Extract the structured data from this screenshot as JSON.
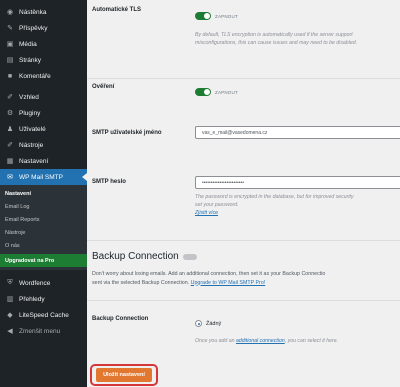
{
  "sidebar": {
    "items_top": [
      {
        "label": "Nástěnka",
        "icon": "dashboard-icon"
      },
      {
        "label": "Příspěvky",
        "icon": "pin-icon"
      },
      {
        "label": "Média",
        "icon": "media-icon"
      },
      {
        "label": "Stránky",
        "icon": "pages-icon"
      },
      {
        "label": "Komentáře",
        "icon": "comments-icon"
      }
    ],
    "items_mid": [
      {
        "label": "Vzhled",
        "icon": "appearance-icon"
      },
      {
        "label": "Pluginy",
        "icon": "plugins-icon"
      },
      {
        "label": "Uživatelé",
        "icon": "users-icon"
      },
      {
        "label": "Nástroje",
        "icon": "tools-icon"
      },
      {
        "label": "Nastavení",
        "icon": "settings-icon"
      }
    ],
    "active": {
      "label": "WP Mail SMTP",
      "icon": "mail-icon"
    },
    "submenu": [
      {
        "label": "Nastavení",
        "state": "current"
      },
      {
        "label": "Email Log",
        "state": ""
      },
      {
        "label": "Email Reports",
        "state": ""
      },
      {
        "label": "Nástroje",
        "state": ""
      },
      {
        "label": "O nás",
        "state": ""
      },
      {
        "label": "Upgradovat na Pro",
        "state": "upgrade"
      }
    ],
    "items_bottom": [
      {
        "label": "Wordfence",
        "icon": "shield-icon"
      },
      {
        "label": "Přehledy",
        "icon": "insights-icon"
      },
      {
        "label": "LiteSpeed Cache",
        "icon": "cache-icon"
      },
      {
        "label": "Zmenšit menu",
        "icon": "collapse-icon"
      }
    ]
  },
  "settings": {
    "auto_tls": {
      "label": "Automatické TLS",
      "toggle_text": "ZAPNOUT",
      "desc1": "By default, TLS encryption is automatically used if the server support",
      "desc2": "misconfigurations, this can cause issues and may need to be disabled."
    },
    "auth": {
      "label": "Ověření",
      "toggle_text": "ZAPNOUT"
    },
    "smtp_user": {
      "label": "SMTP uživatelské jméno",
      "value": "vas_e_mail@vasedomena.cz"
    },
    "smtp_pass": {
      "label": "SMTP heslo",
      "value": "••••••••••••••••••••••••",
      "desc1": "The password is encrypted in the database, but for improved security",
      "desc2": "set your password.",
      "link": "Zjistit více"
    }
  },
  "backup": {
    "title": "Backup Connection",
    "text1": "Don't worry about losing emails. Add an additional connection, then set it as your Backup Connectio",
    "text2_prefix": "sent via the selected Backup Connection.",
    "text2_link": "Upgrade to WP Mail SMTP Pro!",
    "label": "Backup Connection",
    "radio_label": "Žádný",
    "hint_prefix": "Once you add an",
    "hint_link": "additional connection",
    "hint_suffix": ", you can select it here."
  },
  "save_label": "Uložit nastavení",
  "colors": {
    "sidebar_bg": "#1d2327",
    "active_bg": "#2271b1",
    "toggle_on": "#1d7d33",
    "save_button": "#e27730",
    "highlight_border": "#d63638"
  }
}
